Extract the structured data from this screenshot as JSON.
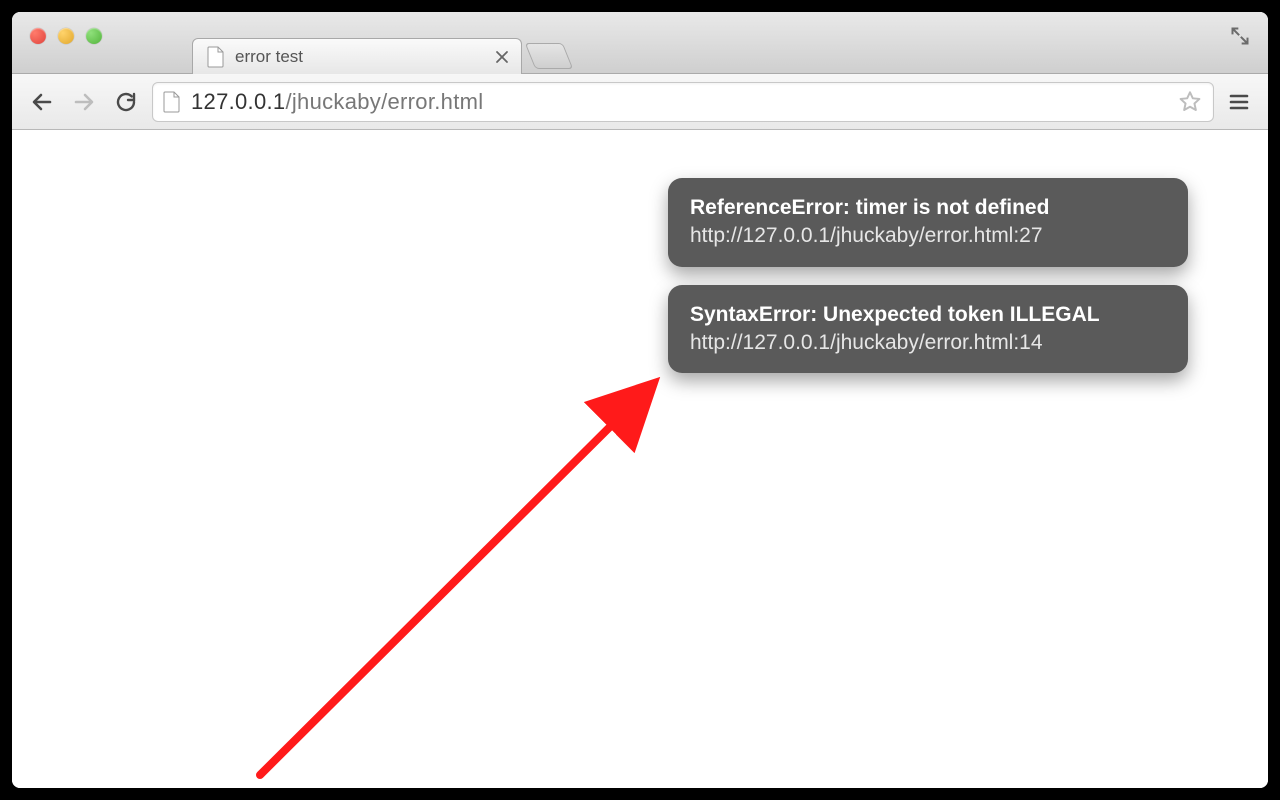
{
  "window": {
    "tab_title": "error test"
  },
  "toolbar": {
    "url_host": "127.0.0.1",
    "url_path": "/jhuckaby/error.html"
  },
  "toasts": [
    {
      "title": "ReferenceError: timer is not defined",
      "detail": "http://127.0.0.1/jhuckaby/error.html:27"
    },
    {
      "title": "SyntaxError: Unexpected token ILLEGAL",
      "detail": "http://127.0.0.1/jhuckaby/error.html:14"
    }
  ],
  "annotation": {
    "arrow_color": "#ff1a1a"
  }
}
